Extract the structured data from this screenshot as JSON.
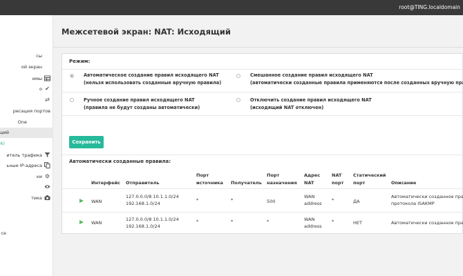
{
  "header": {
    "user": "root@TING.localdomain"
  },
  "sidebar": {
    "items": [
      {
        "label": "сы",
        "icon": ""
      },
      {
        "label": "ой экран",
        "icon": ""
      },
      {
        "label": "имы",
        "icon": "table-icon"
      },
      {
        "label": "о",
        "icon": "check-icon"
      },
      {
        "label": "",
        "icon": "exchange-icon"
      },
      {
        "label": "ресация портов",
        "icon": ""
      },
      {
        "label": "One",
        "icon": ""
      },
      {
        "label": "щий",
        "icon": ""
      },
      {
        "label": "6)",
        "icon": ""
      },
      {
        "label": "итель трафика",
        "icon": "filter-icon"
      },
      {
        "label": "ьные IP-адреса",
        "icon": "copy-icon"
      },
      {
        "label": "ки",
        "icon": "cogs-icon"
      },
      {
        "label": "",
        "icon": "eye-icon"
      },
      {
        "label": "тика",
        "icon": "camera-icon"
      },
      {
        "label": "се",
        "icon": ""
      }
    ]
  },
  "page": {
    "title": "Межсетевой экран: NAT: Исходящий"
  },
  "mode": {
    "title": "Режим:",
    "options": [
      {
        "line1": "Автоматическое создание правил исходящего NAT",
        "line2": "(нельзя использовать созданные вручную правила)",
        "checked": true
      },
      {
        "line1": "Смешанное создание правил исходящего NAT",
        "line2": "(автоматически созданные правила применяются после созданных вручную правил)",
        "checked": false
      },
      {
        "line1": "Ручное создание правил исходящего NAT",
        "line2": "(правила не будут созданы автоматически)",
        "checked": false
      },
      {
        "line1": "Отключить создание правил исходящего NAT",
        "line2": "(исходящий NAT отключен)",
        "checked": false
      }
    ],
    "save_label": "Сохранить"
  },
  "rules": {
    "title": "Автоматически созданные правила:",
    "columns": {
      "interface": "Интерфейс",
      "source": "Отправитель",
      "src_port_1": "Порт",
      "src_port_2": "источника",
      "destination": "Получатель",
      "dst_port_1": "Порт",
      "dst_port_2": "назначения",
      "nat_addr_1": "Адрес",
      "nat_addr_2": "NAT",
      "nat_port_1": "NAT",
      "nat_port_2": "порт",
      "static_1": "Статический",
      "static_2": "порт",
      "description": "Описание"
    },
    "rows": [
      {
        "interface": "WAN",
        "source_1": "127.0.0.0/8 10.1.1.0/24",
        "source_2": "192.168.1.0/24",
        "src_port": "*",
        "destination": "*",
        "dst_port": "500",
        "nat_1": "WAN",
        "nat_2": "address",
        "nat_port": "*",
        "static": "ДА",
        "desc_1": "Автоматически созданное правило",
        "desc_2": "протокола ISAKMP"
      },
      {
        "interface": "WAN",
        "source_1": "127.0.0.0/8 10.1.1.0/24",
        "source_2": "192.168.1.0/24",
        "src_port": "*",
        "destination": "*",
        "dst_port": "*",
        "nat_1": "WAN",
        "nat_2": "address",
        "nat_port": "*",
        "static": "НЕТ",
        "desc_1": "Автоматически созданное правило",
        "desc_2": ""
      }
    ]
  }
}
